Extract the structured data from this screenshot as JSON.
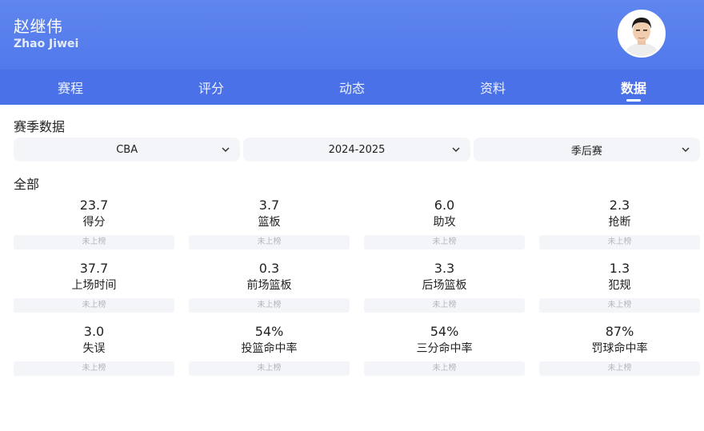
{
  "player": {
    "name_cn": "赵继伟",
    "name_en": "Zhao Jiwei"
  },
  "tabs": [
    {
      "label": "赛程",
      "active": false
    },
    {
      "label": "评分",
      "active": false
    },
    {
      "label": "动态",
      "active": false
    },
    {
      "label": "资料",
      "active": false
    },
    {
      "label": "数据",
      "active": true
    }
  ],
  "season_section": {
    "title": "赛季数据"
  },
  "filters": {
    "league": "CBA",
    "season": "2024-2025",
    "stage": "季后赛"
  },
  "stats_section": {
    "title": "全部"
  },
  "stats": [
    {
      "value": "23.7",
      "label": "得分",
      "rank": "未上榜"
    },
    {
      "value": "3.7",
      "label": "篮板",
      "rank": "未上榜"
    },
    {
      "value": "6.0",
      "label": "助攻",
      "rank": "未上榜"
    },
    {
      "value": "2.3",
      "label": "抢断",
      "rank": "未上榜"
    },
    {
      "value": "37.7",
      "label": "上场时间",
      "rank": "未上榜"
    },
    {
      "value": "0.3",
      "label": "前场篮板",
      "rank": "未上榜"
    },
    {
      "value": "3.3",
      "label": "后场篮板",
      "rank": "未上榜"
    },
    {
      "value": "1.3",
      "label": "犯规",
      "rank": "未上榜"
    },
    {
      "value": "3.0",
      "label": "失误",
      "rank": "未上榜"
    },
    {
      "value": "54%",
      "label": "投篮命中率",
      "rank": "未上榜"
    },
    {
      "value": "54%",
      "label": "三分命中率",
      "rank": "未上榜"
    },
    {
      "value": "87%",
      "label": "罚球命中率",
      "rank": "未上榜"
    }
  ],
  "colors": {
    "header_blue": "#4b71e9",
    "chip_bg": "#f4f5f8",
    "rank_text": "#b3b6bd"
  }
}
